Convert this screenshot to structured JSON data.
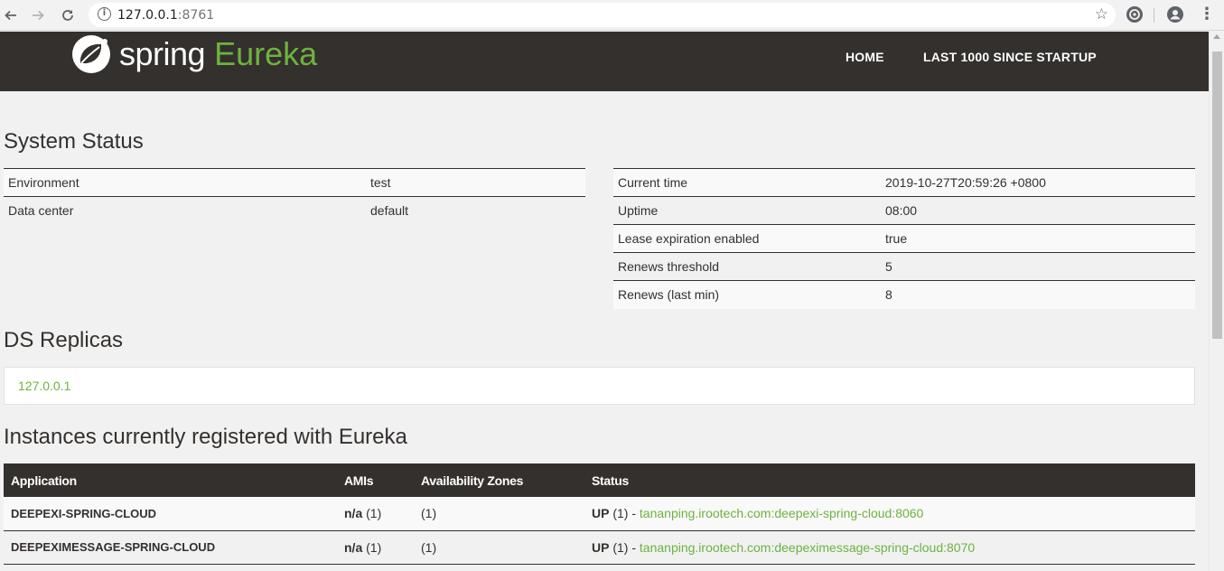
{
  "browser": {
    "url_host": "127.0.0.1",
    "url_port": ":8761",
    "back_icon": "arrow-left-icon",
    "forward_icon": "arrow-right-icon",
    "reload_icon": "reload-icon",
    "star_icon": "star-icon",
    "menu_icon": "more-vert-icon"
  },
  "header": {
    "brand": "spring",
    "product": "Eureka",
    "nav": [
      "HOME",
      "LAST 1000 SINCE STARTUP"
    ],
    "brand_color": "#6db33f",
    "bg_color": "#34302d"
  },
  "system_status": {
    "title": "System Status",
    "left": [
      {
        "key": "Environment",
        "value": "test"
      },
      {
        "key": "Data center",
        "value": "default"
      }
    ],
    "right": [
      {
        "key": "Current time",
        "value": "2019-10-27T20:59:26 +0800"
      },
      {
        "key": "Uptime",
        "value": "08:00"
      },
      {
        "key": "Lease expiration enabled",
        "value": "true"
      },
      {
        "key": "Renews threshold",
        "value": "5"
      },
      {
        "key": "Renews (last min)",
        "value": "8"
      }
    ]
  },
  "replicas": {
    "title": "DS Replicas",
    "items": [
      "127.0.0.1"
    ]
  },
  "instances": {
    "title": "Instances currently registered with Eureka",
    "columns": [
      "Application",
      "AMIs",
      "Availability Zones",
      "Status"
    ],
    "rows": [
      {
        "app": "DEEPEXI-SPRING-CLOUD",
        "ami": "n/a",
        "ami_count": "(1)",
        "zones": "(1)",
        "status": "UP",
        "status_count": "(1) - ",
        "instance": "tananping.irootech.com:deepexi-spring-cloud:8060"
      },
      {
        "app": "DEEPEXIMESSAGE-SPRING-CLOUD",
        "ami": "n/a",
        "ami_count": "(1)",
        "zones": "(1)",
        "status": "UP",
        "status_count": "(1) - ",
        "instance": "tananping.irootech.com:deepeximessage-spring-cloud:8070"
      }
    ]
  }
}
